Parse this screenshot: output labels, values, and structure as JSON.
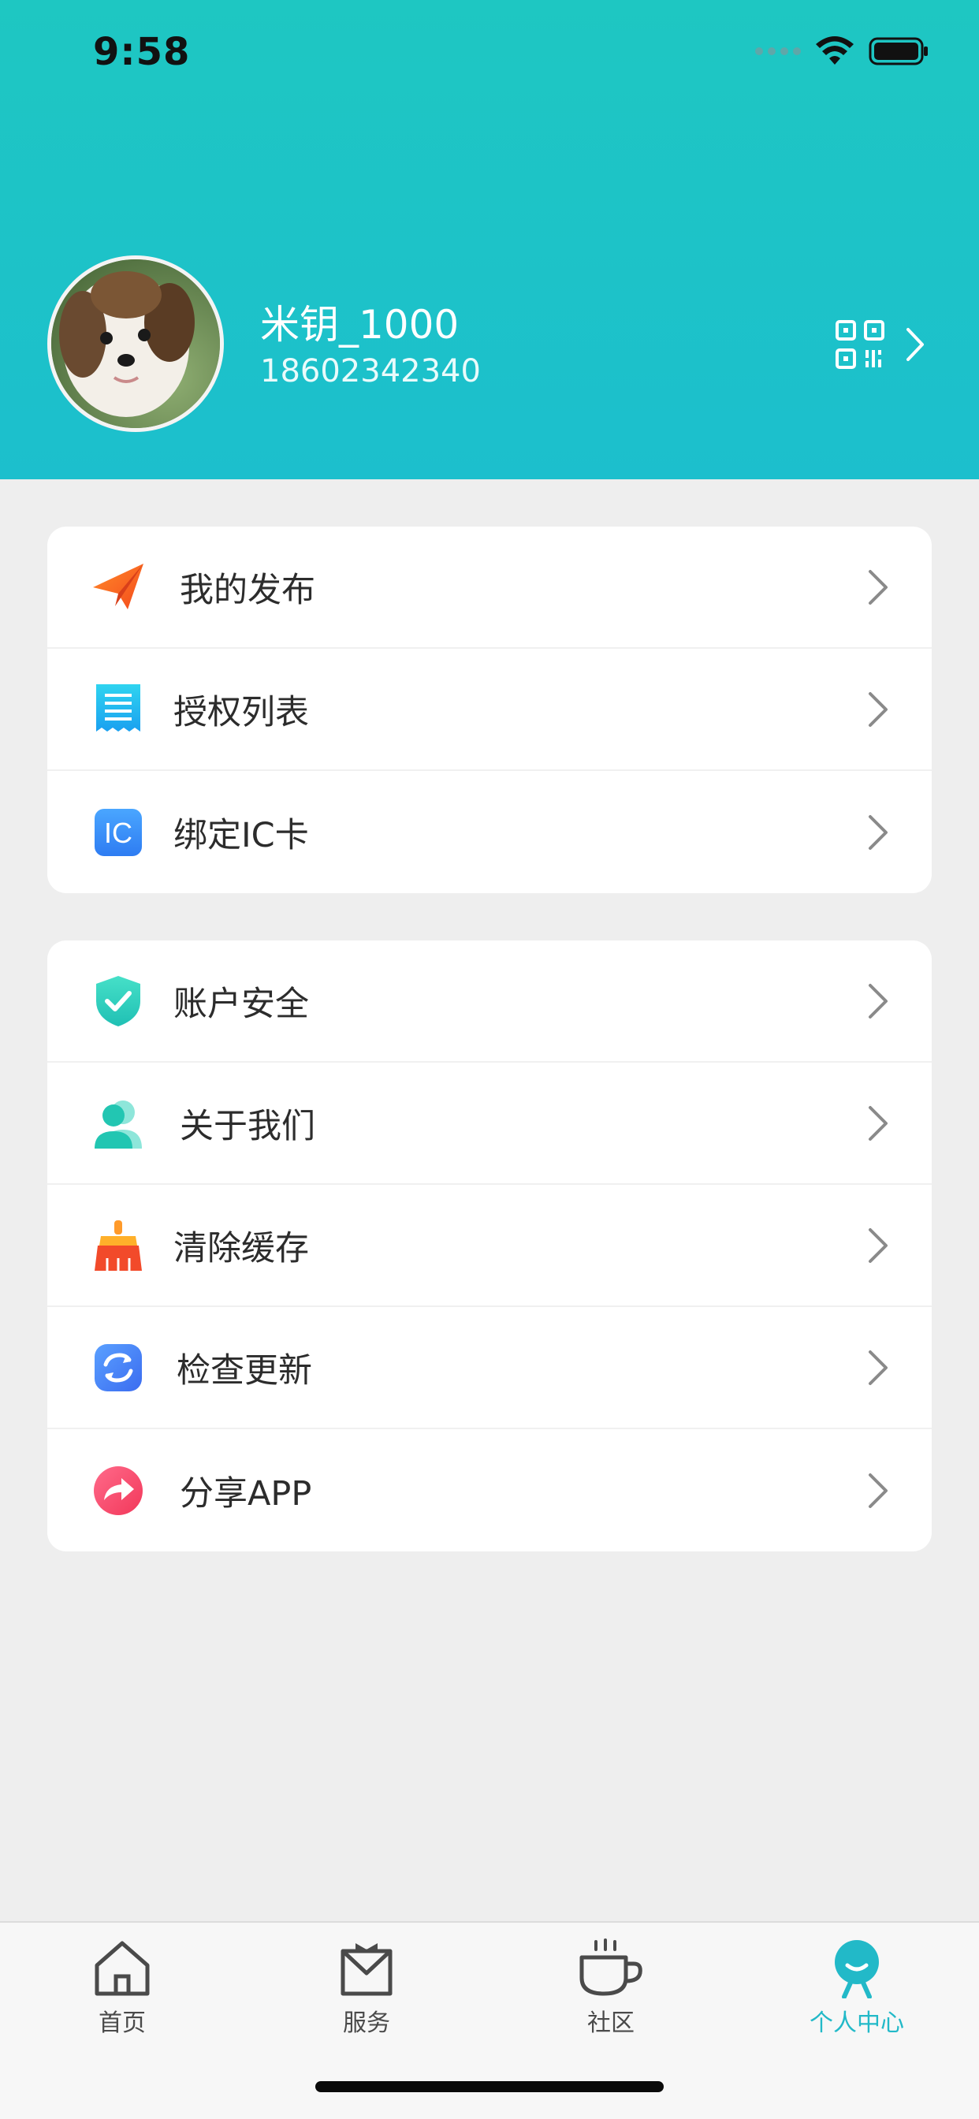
{
  "status_bar": {
    "time": "9:58"
  },
  "profile": {
    "name": "米钥_1000",
    "phone": "18602342340",
    "qr_icon": "qr-code-icon",
    "arrow_icon": "chevron-right-icon"
  },
  "menu_group_1": [
    {
      "label": "我的发布",
      "icon": "paper-plane-icon"
    },
    {
      "label": "授权列表",
      "icon": "receipt-list-icon"
    },
    {
      "label": "绑定IC卡",
      "icon": "ic-card-icon"
    }
  ],
  "menu_group_2": [
    {
      "label": "账户安全",
      "icon": "shield-check-icon"
    },
    {
      "label": "关于我们",
      "icon": "users-icon"
    },
    {
      "label": "清除缓存",
      "icon": "broom-icon"
    },
    {
      "label": "检查更新",
      "icon": "refresh-icon"
    },
    {
      "label": "分享APP",
      "icon": "share-icon"
    }
  ],
  "tabbar": {
    "tabs": [
      {
        "label": "首页",
        "icon": "home-icon",
        "active": false
      },
      {
        "label": "服务",
        "icon": "service-bag-icon",
        "active": false
      },
      {
        "label": "社区",
        "icon": "coffee-cup-icon",
        "active": false
      },
      {
        "label": "个人中心",
        "icon": "profile-icon",
        "active": true
      }
    ]
  },
  "colors": {
    "header_start": "#1ec7c2",
    "header_end": "#1cbfcd",
    "active_tab": "#22b9c8",
    "page_bg": "#eeeeee"
  }
}
